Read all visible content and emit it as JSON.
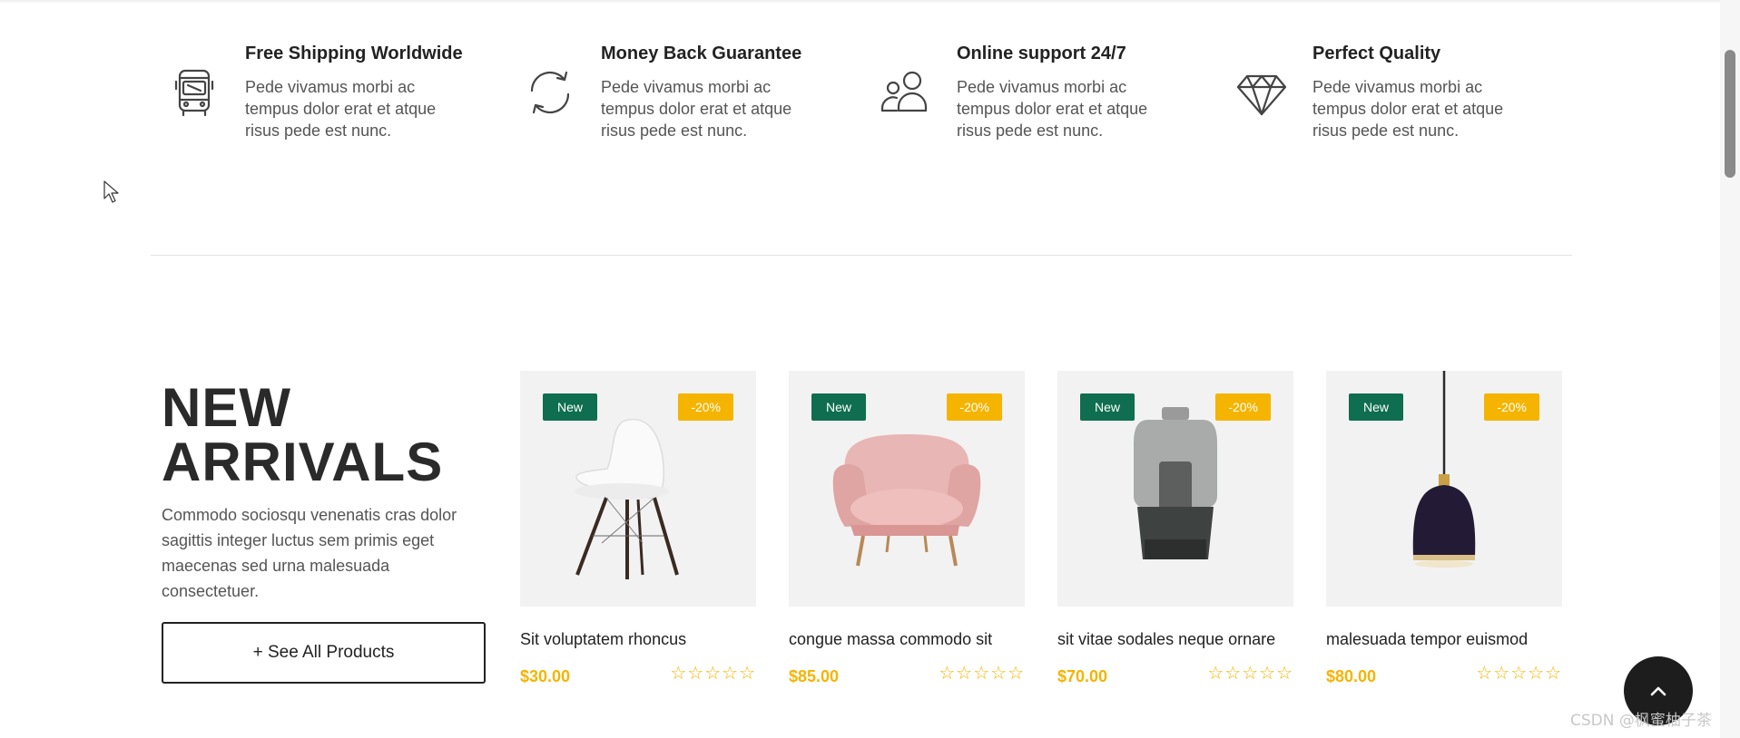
{
  "features": [
    {
      "icon": "bus-icon",
      "title": "Free Shipping Worldwide",
      "desc": "Pede vivamus morbi ac tempus dolor erat et atque risus pede est nunc."
    },
    {
      "icon": "refresh-icon",
      "title": "Money Back Guarantee",
      "desc": "Pede vivamus morbi ac tempus dolor erat et atque risus pede est nunc."
    },
    {
      "icon": "users-icon",
      "title": "Online support 24/7",
      "desc": "Pede vivamus morbi ac tempus dolor erat et atque risus pede est nunc."
    },
    {
      "icon": "diamond-icon",
      "title": "Perfect Quality",
      "desc": "Pede vivamus morbi ac tempus dolor erat et atque risus pede est nunc."
    }
  ],
  "arrivals": {
    "heading_line1": "NEW",
    "heading_line2": "ARRIVALS",
    "desc": "Commodo sociosqu venenatis cras dolor sagittis integer luctus sem primis eget maecenas sed urna malesuada consectetuer.",
    "button_label": "+ See All Products"
  },
  "products": [
    {
      "name": "Sit voluptatem rhoncus",
      "price": "$30.00",
      "badge": "New",
      "discount": "-20%",
      "image": "chair",
      "rating": 0
    },
    {
      "name": "congue massa commodo sit",
      "price": "$85.00",
      "badge": "New",
      "discount": "-20%",
      "image": "armchair",
      "rating": 0
    },
    {
      "name": "sit vitae sodales neque ornare",
      "price": "$70.00",
      "badge": "New",
      "discount": "-20%",
      "image": "lamp",
      "rating": 0
    },
    {
      "name": "malesuada tempor euismod",
      "price": "$80.00",
      "badge": "New",
      "discount": "-20%",
      "image": "pendant",
      "rating": 0
    }
  ],
  "stars": "☆☆☆☆☆",
  "watermark": "CSDN @枫蜜柚子茶",
  "colors": {
    "accent": "#f5b400",
    "badge_new": "#0f6e4f",
    "dark": "#1d1d1d"
  }
}
